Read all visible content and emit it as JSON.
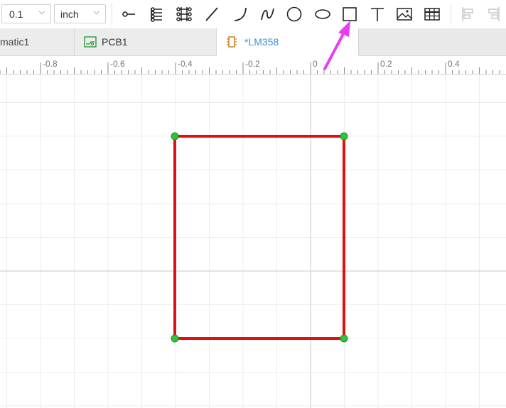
{
  "toolbar": {
    "grid_size": "0.1",
    "unit": "inch",
    "tools": [
      {
        "name": "pin-icon"
      },
      {
        "name": "pin-row-icon"
      },
      {
        "name": "pin-grid-icon"
      },
      {
        "name": "line-icon"
      },
      {
        "name": "arc-icon"
      },
      {
        "name": "bezier-curve-icon"
      },
      {
        "name": "circle-icon"
      },
      {
        "name": "ellipse-icon"
      },
      {
        "name": "rectangle-icon",
        "highlighted": true
      },
      {
        "name": "text-icon"
      },
      {
        "name": "image-icon"
      },
      {
        "name": "table-icon"
      },
      {
        "name": "align-left-icon",
        "disabled": true
      },
      {
        "name": "align-right-icon",
        "disabled": true
      }
    ]
  },
  "tabs": [
    {
      "label": "matic1",
      "icon": "none",
      "active": false
    },
    {
      "label": "PCB1",
      "icon": "pcb-icon",
      "active": false
    },
    {
      "label": "*LM358",
      "icon": "symbol-icon",
      "active": true
    }
  ],
  "ruler": {
    "labels": [
      "-0.8",
      "-0.6",
      "-0.4",
      "-0.2",
      "0",
      "0.2",
      "0.4"
    ]
  },
  "canvas": {
    "shape": {
      "type": "rectangle",
      "stroke_color": "#e01010",
      "handle_color": "#2ec43a"
    }
  },
  "annotation": {
    "arrow_color": "#e63df5",
    "points_to": "rectangle-icon"
  }
}
